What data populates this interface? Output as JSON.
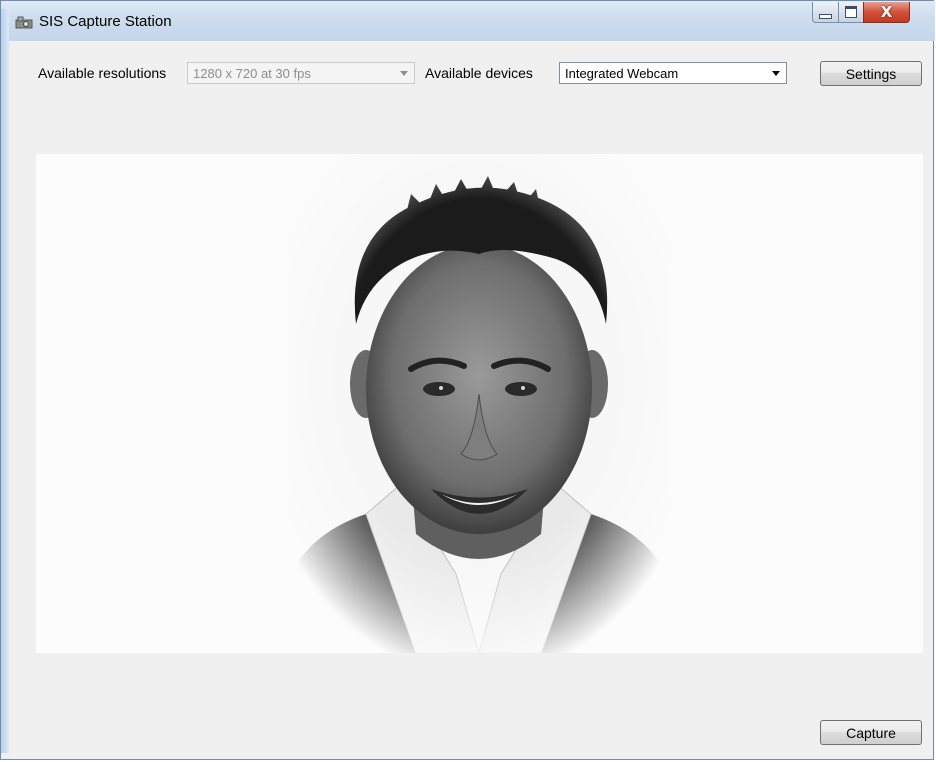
{
  "window": {
    "title": "SIS Capture Station"
  },
  "toolbar": {
    "resolutions_label": "Available resolutions",
    "resolution_value": "1280 x 720 at 30 fps",
    "devices_label": "Available devices",
    "device_value": "Integrated Webcam",
    "settings_label": "Settings"
  },
  "preview": {
    "content": "webcam-preview-portrait"
  },
  "footer": {
    "capture_label": "Capture"
  },
  "icons": {
    "app": "camera-icon",
    "minimize": "minimize-icon",
    "maximize": "maximize-icon",
    "close": "close-icon",
    "dropdown": "chevron-down-icon"
  },
  "colors": {
    "titlebar": "#c9daef",
    "window_bg": "#f0f0f0",
    "close_button": "#c7432b",
    "preview_bg": "#fcfcfc"
  }
}
